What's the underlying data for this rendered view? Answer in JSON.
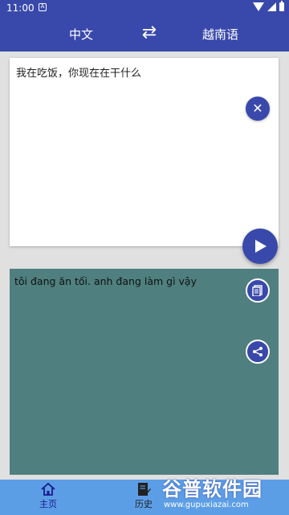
{
  "status_bar": {
    "time": "11:00",
    "notification_icon": "app-notification-icon",
    "wifi_icon": "wifi-icon",
    "signal_icon": "signal-icon",
    "battery_icon": "battery-icon"
  },
  "header": {
    "source_language": "中文",
    "swap_icon": "swap-icon",
    "target_language": "越南语"
  },
  "input": {
    "text": "我在吃饭，你现在在干什么",
    "clear_icon": "close-icon"
  },
  "send_icon": "send-icon",
  "output": {
    "text": "tôi đang ăn tối. anh đang làm gì vậy",
    "copy_icon": "copy-icon",
    "share_icon": "share-icon"
  },
  "bottom_nav": {
    "home_label": "主页",
    "history_label": "历史"
  },
  "watermark": {
    "title": "谷普软件园",
    "url": "www.gupuxiazai.com"
  },
  "colors": {
    "primary": "#3949ab",
    "output_bg": "#4f7f7f",
    "bottom_nav_bg": "#5c9ee6",
    "page_bg": "#e0e0e0"
  }
}
